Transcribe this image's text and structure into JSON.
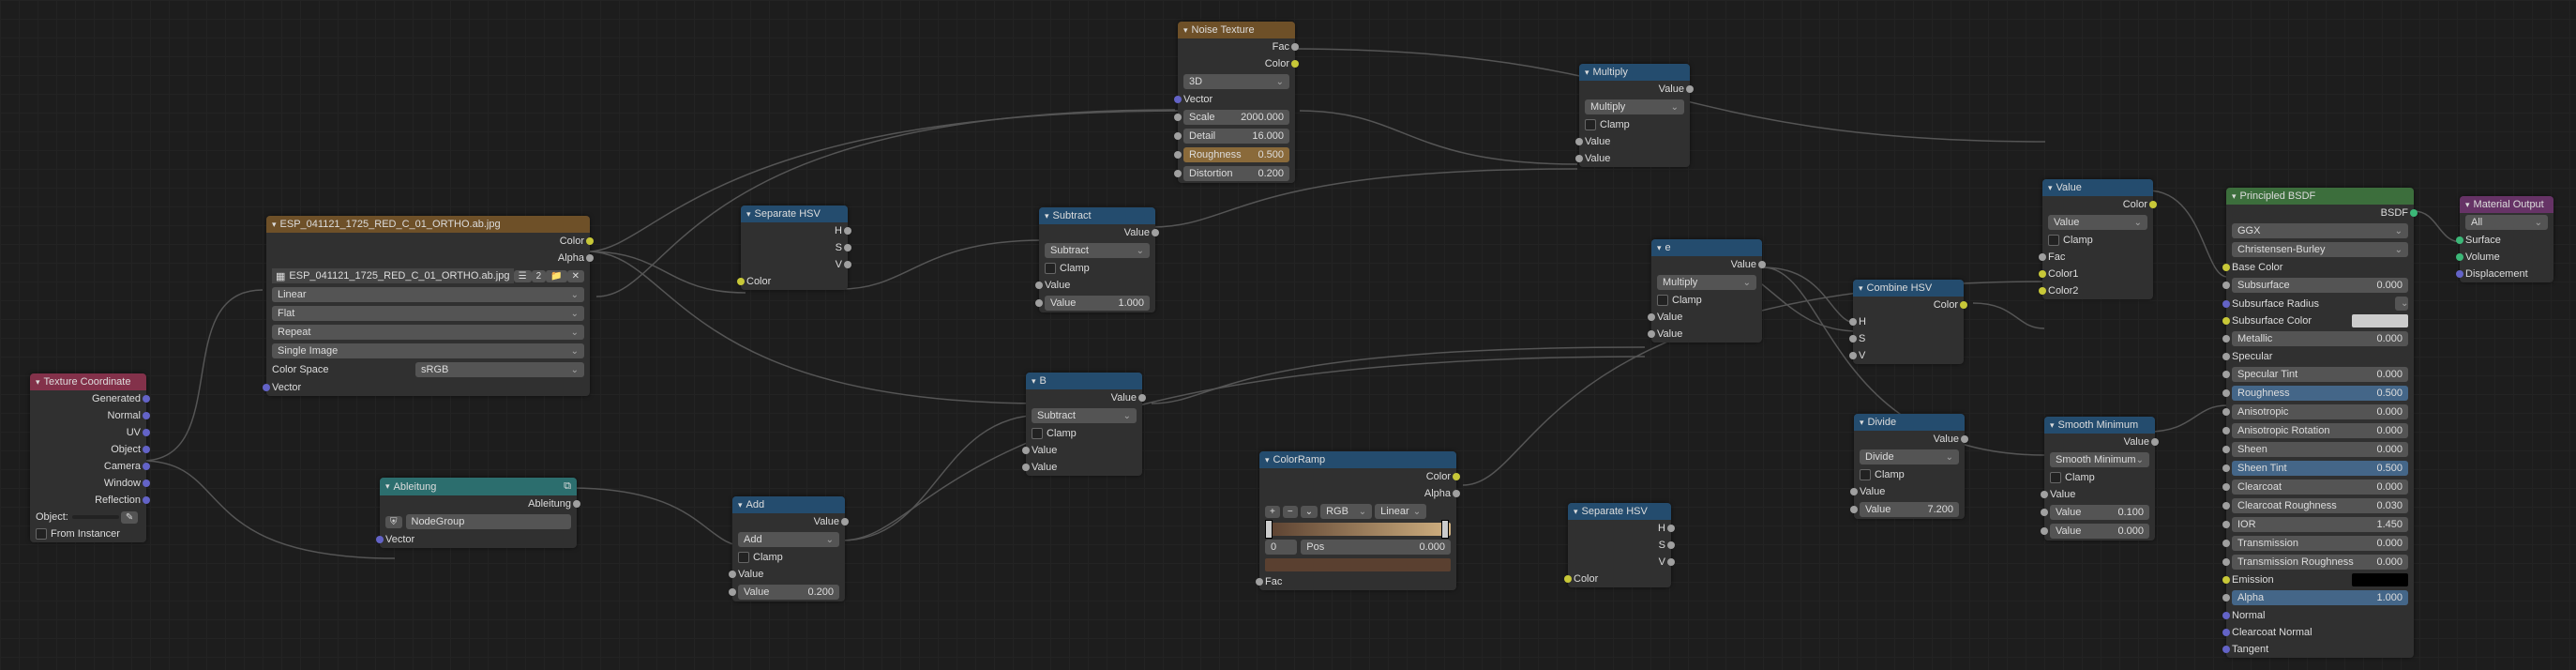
{
  "tex_coord": {
    "title": "Texture Coordinate",
    "outputs": [
      "Generated",
      "Normal",
      "UV",
      "Object",
      "Camera",
      "Window",
      "Reflection"
    ],
    "object_label": "Object:",
    "from_instancer": "From Instancer"
  },
  "image_tex": {
    "title": "ESP_041121_1725_RED_C_01_ORTHO.ab.jpg",
    "out_color": "Color",
    "out_alpha": "Alpha",
    "filename": "ESP_041121_1725_RED_C_01_ORTHO.ab.jpg",
    "interp": "Linear",
    "proj": "Flat",
    "ext": "Repeat",
    "frame": "Single Image",
    "cs_label": "Color Space",
    "cs_val": "sRGB",
    "in_vector": "Vector"
  },
  "ableitung": {
    "title": "Ableitung",
    "out": "Ableitung",
    "group": "NodeGroup",
    "in_vector": "Vector"
  },
  "sep_hsv1": {
    "title": "Separate HSV",
    "h": "H",
    "s": "S",
    "v": "V",
    "in_color": "Color"
  },
  "add": {
    "title": "Add",
    "out": "Value",
    "op": "Add",
    "clamp": "Clamp",
    "in_val": "Value",
    "val_lit_label": "Value",
    "val_lit": "0.200"
  },
  "noise": {
    "title": "Noise Texture",
    "out_fac": "Fac",
    "out_color": "Color",
    "dim": "3D",
    "in_vector": "Vector",
    "scale_l": "Scale",
    "scale_v": "2000.000",
    "detail_l": "Detail",
    "detail_v": "16.000",
    "rough_l": "Roughness",
    "rough_v": "0.500",
    "dist_l": "Distortion",
    "dist_v": "0.200"
  },
  "subtract1": {
    "title": "Subtract",
    "out": "Value",
    "op": "Subtract",
    "clamp": "Clamp",
    "in_val": "Value",
    "val_lit_l": "Value",
    "val_lit": "1.000"
  },
  "math_b": {
    "title": "B",
    "out": "Value",
    "op": "Subtract",
    "clamp": "Clamp",
    "v1": "Value",
    "v2": "Value"
  },
  "colorramp": {
    "title": "ColorRamp",
    "out_color": "Color",
    "out_alpha": "Alpha",
    "mode": "RGB",
    "interp": "Linear",
    "pos_l": "Pos",
    "pos_v": "0.000",
    "idx": "0",
    "in_fac": "Fac"
  },
  "multiply1": {
    "title": "Multiply",
    "out": "Value",
    "op": "Multiply",
    "clamp": "Clamp",
    "v1": "Value",
    "v2": "Value"
  },
  "math_e": {
    "title": "e",
    "out": "Value",
    "op": "Multiply",
    "clamp": "Clamp",
    "v1": "Value",
    "v2": "Value"
  },
  "sep_hsv2": {
    "title": "Separate HSV",
    "h": "H",
    "s": "S",
    "v": "V",
    "in_color": "Color"
  },
  "combine_hsv": {
    "title": "Combine HSV",
    "out": "Color",
    "h": "H",
    "s": "S",
    "v": "V"
  },
  "divide": {
    "title": "Divide",
    "out": "Value",
    "op": "Divide",
    "clamp": "Clamp",
    "v1": "Value",
    "v2_l": "Value",
    "v2": "7.200"
  },
  "value_node": {
    "title": "Value",
    "out": "Color",
    "clamp": "Clamp",
    "in_fac": "Fac",
    "in_c1": "Color1",
    "in_c2": "Color2"
  },
  "smooth_min": {
    "title": "Smooth Minimum",
    "out": "Value",
    "op": "Smooth Minimum",
    "clamp": "Clamp",
    "v1": "Value",
    "v1v": "0.100",
    "v2": "Value",
    "v2v": "0.000"
  },
  "bsdf": {
    "title": "Principled BSDF",
    "out": "BSDF",
    "dist": "GGX",
    "sss": "Christensen-Burley",
    "base_color": "Base Color",
    "subsurface_l": "Subsurface",
    "subsurface_v": "0.000",
    "ssr": "Subsurface Radius",
    "ssc": "Subsurface Color",
    "metallic_l": "Metallic",
    "metallic_v": "0.000",
    "specular": "Specular",
    "spectint_l": "Specular Tint",
    "spectint_v": "0.000",
    "rough_l": "Roughness",
    "rough_v": "0.500",
    "aniso_l": "Anisotropic",
    "aniso_v": "0.000",
    "anisor_l": "Anisotropic Rotation",
    "anisor_v": "0.000",
    "sheen_l": "Sheen",
    "sheen_v": "0.000",
    "sheent_l": "Sheen Tint",
    "sheent_v": "0.500",
    "clear_l": "Clearcoat",
    "clear_v": "0.000",
    "clearr_l": "Clearcoat Roughness",
    "clearr_v": "0.030",
    "ior_l": "IOR",
    "ior_v": "1.450",
    "trans_l": "Transmission",
    "trans_v": "0.000",
    "transr_l": "Transmission Roughness",
    "transr_v": "0.000",
    "emission": "Emission",
    "alpha_l": "Alpha",
    "alpha_v": "1.000",
    "normal": "Normal",
    "cnormal": "Clearcoat Normal",
    "tangent": "Tangent"
  },
  "mat_out": {
    "title": "Material Output",
    "target": "All",
    "surface": "Surface",
    "volume": "Volume",
    "disp": "Displacement"
  }
}
